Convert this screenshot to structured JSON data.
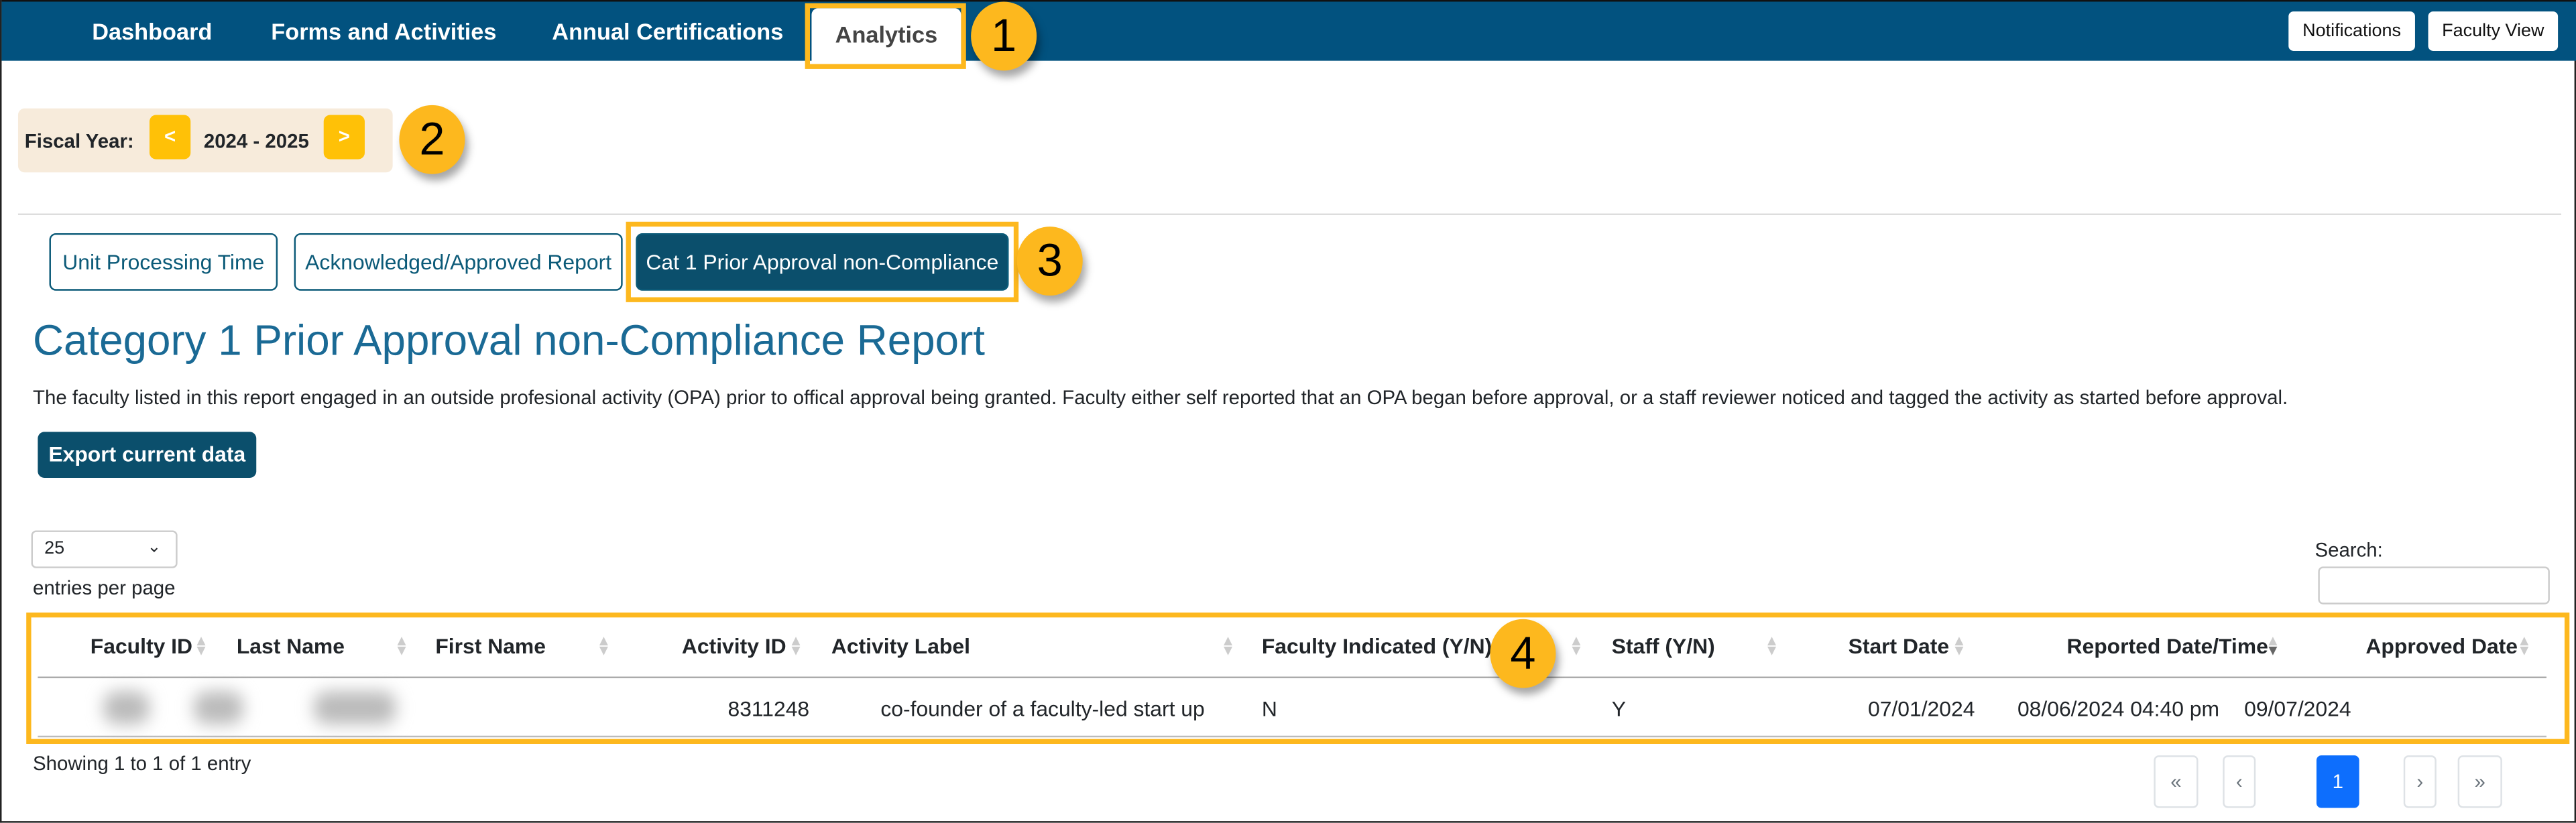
{
  "nav": {
    "items": [
      "Dashboard",
      "Forms and Activities",
      "Annual Certifications"
    ],
    "active": "Analytics",
    "notifications_label": "Notifications",
    "faculty_view_label": "Faculty View"
  },
  "callouts": [
    "1",
    "2",
    "3",
    "4"
  ],
  "fiscal_year": {
    "label": "Fiscal Year:",
    "prev": "<",
    "value": "2024 - 2025",
    "next": ">"
  },
  "report_tabs": [
    "Unit Processing Time",
    "Acknowledged/Approved Report",
    "Cat 1 Prior Approval non-Compliance"
  ],
  "report": {
    "title": "Category 1 Prior Approval non-Compliance Report",
    "description": "The faculty listed in this report engaged in an outside profesional activity (OPA) prior to offical approval being granted. Faculty either self reported that an OPA began before approval, or a staff reviewer noticed and tagged the activity as started before approval.",
    "export_label": "Export current data"
  },
  "table_controls": {
    "page_size": "25",
    "page_size_label": "entries per page",
    "search_label": "Search:",
    "search_value": ""
  },
  "table": {
    "columns": [
      "Faculty ID",
      "Last Name",
      "First Name",
      "Activity ID",
      "Activity Label",
      "Faculty Indicated (Y/N)",
      "Staff (Y/N)",
      "Start Date",
      "Reported Date/Time",
      "Approved Date"
    ],
    "rows": [
      {
        "activity_id": "8311248",
        "activity_label": "co-founder of a faculty-led start up",
        "faculty_indicated": "N",
        "staff": "Y",
        "start_date": "07/01/2024",
        "reported": "08/06/2024 04:40 pm",
        "approved": "09/07/2024"
      }
    ],
    "sorted_column": "Reported Date/Time",
    "sort_direction": "descending"
  },
  "footer": {
    "info": "Showing 1 to 1 of 1 entry",
    "pagination": {
      "first": "«",
      "prev": "‹",
      "current": "1",
      "next": "›",
      "last": "»"
    }
  },
  "colors": {
    "nav": "#02527f",
    "callout": "#fdb81e",
    "accent": "#0b5a78",
    "page_active": "#0d6efd"
  }
}
